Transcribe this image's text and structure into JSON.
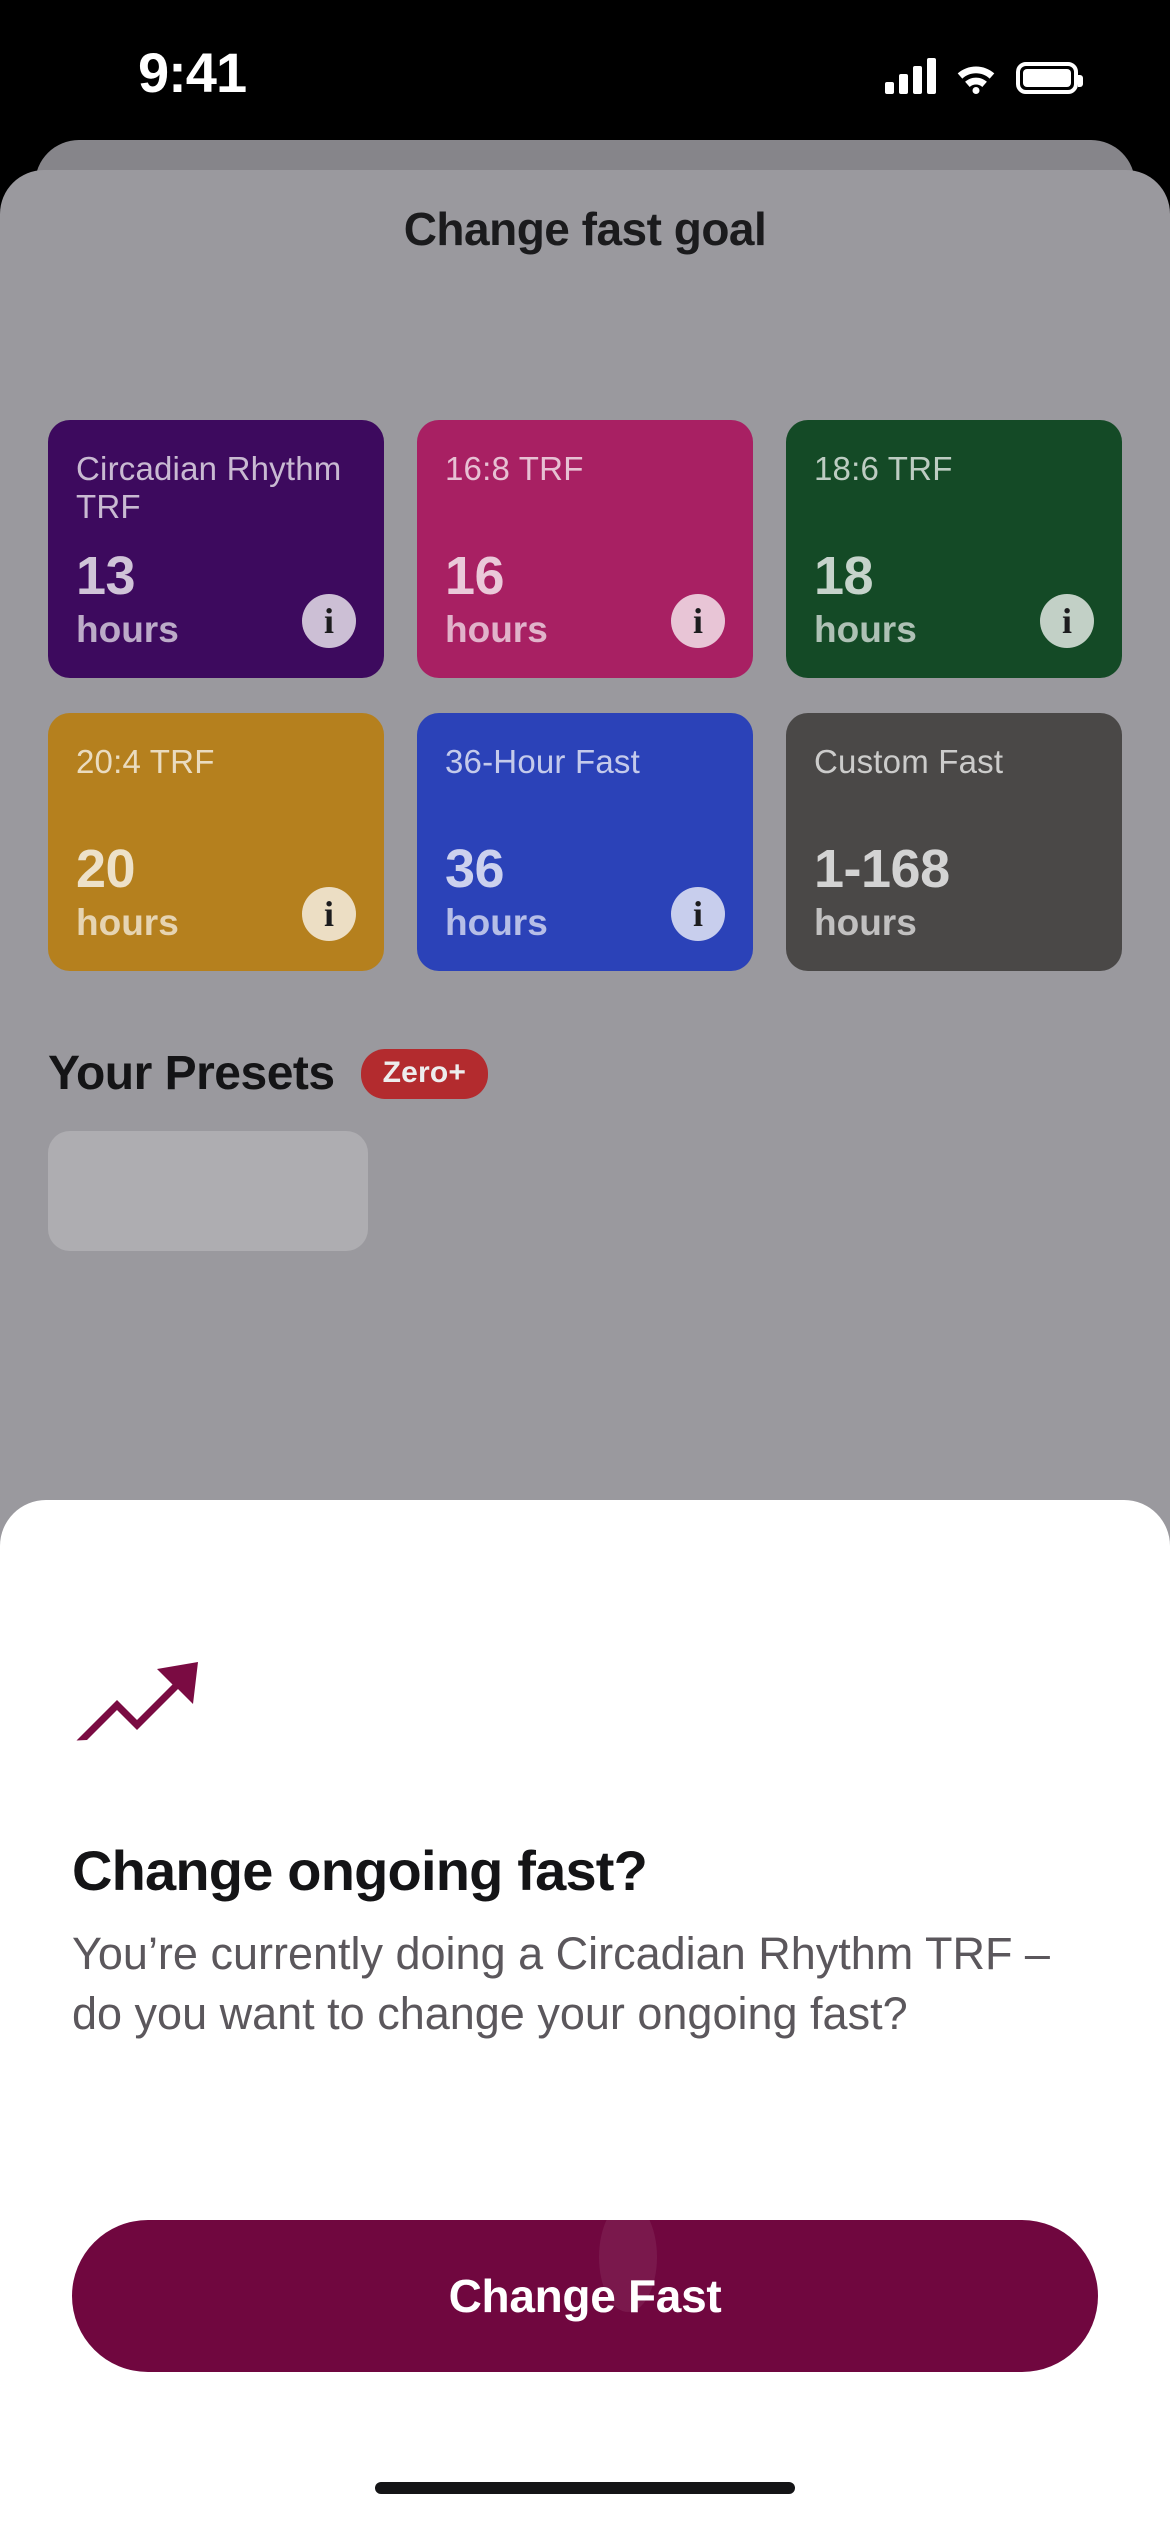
{
  "status_bar": {
    "time": "9:41",
    "icons": [
      "cellular-signal-icon",
      "wifi-icon",
      "battery-icon"
    ]
  },
  "sheet": {
    "title": "Change fast goal",
    "close_icon": "close-icon",
    "presets": [
      {
        "label": "Circadian Rhythm TRF",
        "hours_value": "13",
        "hours_unit": "hours",
        "color": "#3D0A5E",
        "has_info": true
      },
      {
        "label": "16:8 TRF",
        "hours_value": "16",
        "hours_unit": "hours",
        "color": "#A82063",
        "has_info": true
      },
      {
        "label": "18:6 TRF",
        "hours_value": "18",
        "hours_unit": "hours",
        "color": "#144A26",
        "has_info": true
      },
      {
        "label": "20:4 TRF",
        "hours_value": "20",
        "hours_unit": "hours",
        "color": "#B5801E",
        "has_info": true
      },
      {
        "label": "36-Hour Fast",
        "hours_value": "36",
        "hours_unit": "hours",
        "color": "#2B42B8",
        "has_info": true
      },
      {
        "label": "Custom Fast",
        "hours_value": "1-168",
        "hours_unit": "hours",
        "color": "#4A4847",
        "has_info": false
      }
    ],
    "your_presets": {
      "title": "Your Presets",
      "badge": "Zero+",
      "badge_color": "#B32B2E"
    }
  },
  "dialog": {
    "close_icon": "close-icon",
    "hero_icon": "trending-up-icon",
    "hero_icon_color": "#7A0B42",
    "title": "Change ongoing fast?",
    "body": "You’re currently doing a Circadian Rhythm TRF – do you want to change your ongoing fast?",
    "primary_button": {
      "label": "Change Fast",
      "color": "#70073F",
      "text_color": "#FFFFFF"
    }
  }
}
